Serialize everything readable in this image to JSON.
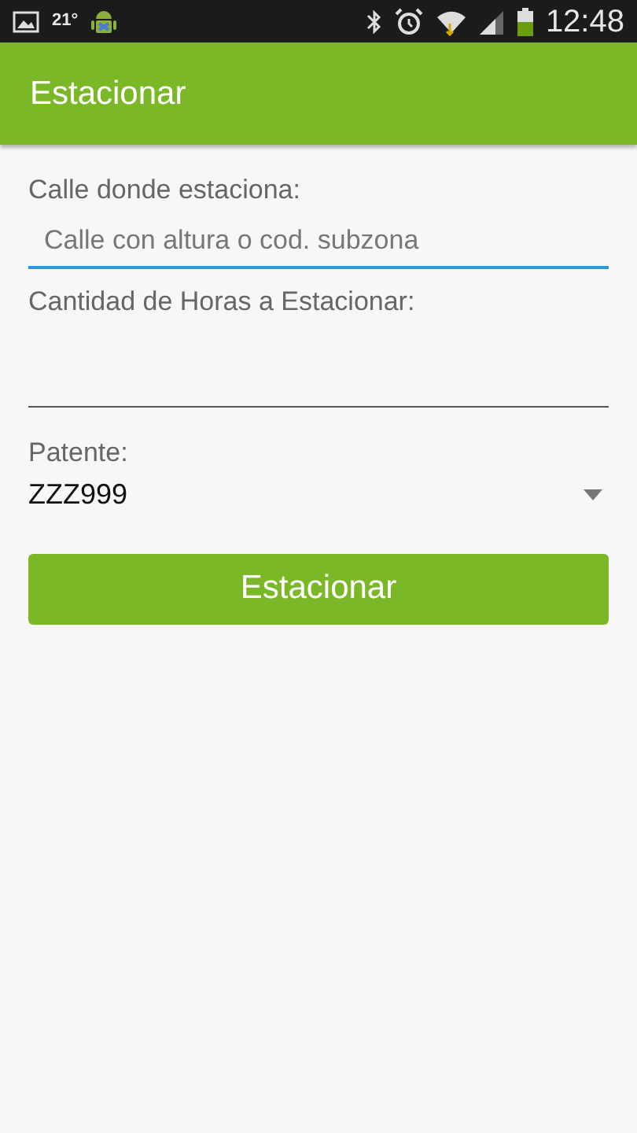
{
  "status_bar": {
    "temperature": "21°",
    "time": "12:48"
  },
  "app_bar": {
    "title": "Estacionar"
  },
  "fields": [
    {
      "label": "Calle donde estaciona:",
      "placeholder": "Calle con altura o cod. subzona",
      "focused": true
    },
    {
      "label": "Cantidad de Horas a Estacionar:",
      "focused": false
    }
  ],
  "spinner": {
    "label": "Patente:",
    "value": "ZZZ999"
  },
  "button": {
    "label": "Estacionar"
  }
}
